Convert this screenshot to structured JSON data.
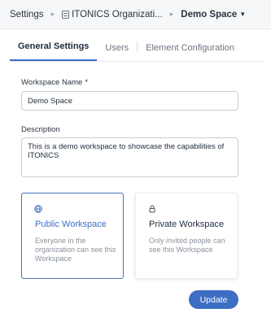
{
  "breadcrumb": {
    "root": "Settings",
    "organization": "ITONICS Organizati...",
    "current": "Demo Space"
  },
  "tabs": [
    {
      "label": "General Settings",
      "active": true
    },
    {
      "label": "Users",
      "active": false
    },
    {
      "label": "Element Configuration",
      "active": false
    }
  ],
  "form": {
    "workspace_name_label": "Workspace Name",
    "required_marker": "*",
    "workspace_name_value": "Demo Space",
    "description_label": "Description",
    "description_value": "This is a demo workspace to showcase the capabilities of ITONICS"
  },
  "visibility": {
    "public": {
      "title": "Public Workspace",
      "description": "Everyone in the organization can see this Workspace",
      "icon": "globe-icon",
      "selected": true
    },
    "private": {
      "title": "Private Workspace",
      "description": "Only invited people can see this Workspace",
      "icon": "lock-icon",
      "selected": false
    }
  },
  "actions": {
    "update_label": "Update"
  },
  "colors": {
    "accent": "#3d6ec4",
    "selected_border": "#4a73b8",
    "muted_text": "#8a929c"
  }
}
